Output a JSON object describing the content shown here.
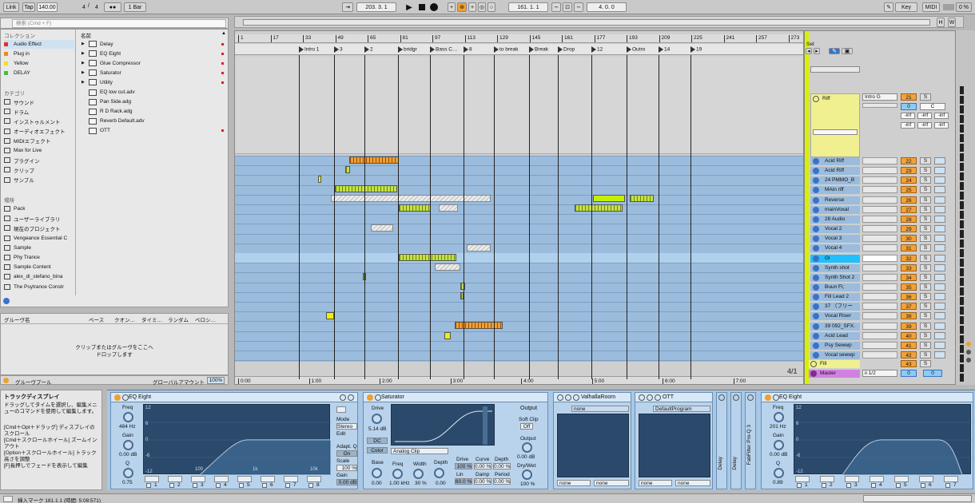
{
  "topbar": {
    "link": "Link",
    "tap": "Tap",
    "tempo": "140.00",
    "signature_num": "4",
    "signature_den": "4",
    "metronome": "●●",
    "quantize": "1 Bar",
    "position": "203.  3.  1",
    "loop_start": "161.  1.  1",
    "loop_length": "4.  0.  0",
    "key": "Key",
    "midi": "MIDI",
    "cpu": "0 %"
  },
  "browser": {
    "search_placeholder": "検索 (Cmd + F)",
    "collections_title": "コレクション",
    "collections": [
      {
        "label": "Audio Effect",
        "color": "#e03030"
      },
      {
        "label": "Plug in",
        "color": "#f08a20"
      },
      {
        "label": "Yellow",
        "color": "#f0e020"
      },
      {
        "label": "DELAY",
        "color": "#40c040"
      }
    ],
    "categories_title": "カテゴリ",
    "categories": [
      "サウンド",
      "ドラム",
      "インストゥルメント",
      "オーディオエフェクト",
      "MIDIエフェクト",
      "Max for Live",
      "プラグイン",
      "クリップ",
      "サンプル"
    ],
    "places_title": "場所",
    "places": [
      "Pack",
      "ユーザーライブラリ",
      "現在のプロジェクト",
      "Vengeance Essential C",
      "Sample",
      "Phy Trance",
      "Sample Content",
      "alex_di_stefano_bina",
      "The Psytrance Constr"
    ],
    "name_header": "名前",
    "files": [
      "Delay",
      "EQ Eight",
      "Glue Compressor",
      "Saturator",
      "Utility",
      "EQ low cut.adv",
      "Pan Side.adg",
      "R D Rack.adg",
      "Reverb Default.adv",
      "OTT"
    ]
  },
  "groove": {
    "headers": [
      "グルーヴ名",
      "ベース",
      "クオン…",
      "タイミ…",
      "ランダム",
      "ベロシ…"
    ],
    "drop_hint_1": "クリップまたはグルーヴをここへ",
    "drop_hint_2": "ドロップします",
    "pool_label": "グルーヴプール",
    "global_amount_label": "グローバルアマウント",
    "global_amount": "100%"
  },
  "arrangement": {
    "bars": [
      "1",
      "17",
      "33",
      "49",
      "65",
      "81",
      "97",
      "113",
      "129",
      "145",
      "161",
      "177",
      "193",
      "209",
      "225",
      "241",
      "257",
      "273"
    ],
    "locators": [
      "Intro 1",
      "3",
      "2",
      "bridgr",
      "Bass C…",
      "8",
      "to break",
      "Break",
      "Drop",
      "12",
      "Outro",
      "14",
      "19"
    ],
    "times": [
      "0:00",
      "1:00",
      "2:00",
      "3:00",
      "4:00",
      "5:00",
      "6:00",
      "7:00"
    ],
    "loop_fraction": "4/1"
  },
  "mixer": {
    "set_label": "Set",
    "riff": {
      "name": "Riff",
      "input": "Intro G",
      "num": "21",
      "vol": "0",
      "pan": "C",
      "inf": "-inf"
    },
    "tracks": [
      {
        "name": "Acid Riff",
        "num": "22"
      },
      {
        "name": "Acid Riff",
        "num": "23"
      },
      {
        "name": "24 PMMO_B",
        "num": "24"
      },
      {
        "name": "MAin riff",
        "num": "25"
      },
      {
        "name": "Reverse",
        "num": "26"
      },
      {
        "name": "mainVoxal",
        "num": "27"
      },
      {
        "name": "28 Audio",
        "num": "28"
      },
      {
        "name": "Vocal 2",
        "num": "29"
      },
      {
        "name": "Vocal 3",
        "num": "30"
      },
      {
        "name": "Vocal 4",
        "num": "31"
      },
      {
        "name": "Gl",
        "num": "32"
      },
      {
        "name": "Synth shot",
        "num": "33"
      },
      {
        "name": "Synth Shot 2",
        "num": "34"
      },
      {
        "name": "Buun Fi;",
        "num": "35"
      },
      {
        "name": "Fill Lead 2",
        "num": "36"
      },
      {
        "name": "37 （フリー",
        "num": "37"
      },
      {
        "name": "Vocal Riser",
        "num": "38"
      },
      {
        "name": "39 092_SFX.",
        "num": "39"
      },
      {
        "name": "Acid Lead",
        "num": "40"
      },
      {
        "name": "Psy Sewwp",
        "num": "41"
      },
      {
        "name": "Vocal sewwp",
        "num": "42"
      }
    ],
    "fill": {
      "name": "Fill",
      "num": "43"
    },
    "master": {
      "name": "Master",
      "input": "ii 1/2",
      "vol": "0",
      "pan": "0"
    },
    "solo": "S"
  },
  "info": {
    "title": "トラックディスプレイ",
    "lines": [
      "ドラッグしてタイムを選択し、編集メニューのコマンドを使用して編集します。",
      "[Cmd＋Opt＋ドラッグ] ディスプレイのスクロール",
      "[Cmd＋スクロールホイール] ズームインアウト",
      "[Option＋スクロールホイール] トラック高さを調整",
      "[F]長押しでフェードを表示して編集"
    ]
  },
  "devices": {
    "eq1": {
      "title": "EQ Eight",
      "freq_label": "Freq",
      "freq": "484 Hz",
      "gain_label": "Gain",
      "gain": "0.00 dB",
      "q_label": "Q",
      "q": "0.75",
      "mode_label": "Mode",
      "mode": "Stereo",
      "edit_label": "Edit",
      "adapt_label": "Adapt. Q",
      "adapt": "On",
      "scale_label": "Scale",
      "scale": "100 %",
      "out_gain_label": "Gain",
      "out_gain": "0.00 dB",
      "db_ticks": [
        "12",
        "6",
        "0",
        "-6",
        "-12"
      ],
      "freq_ticks": [
        "100",
        "1k",
        "10k"
      ],
      "bands": [
        "1",
        "2",
        "3",
        "4",
        "5",
        "6",
        "7",
        "8"
      ]
    },
    "saturator": {
      "title": "Saturator",
      "drive_label": "Drive",
      "drive": "5.14 dB",
      "dc": "DC",
      "color": "Color",
      "type": "Analog Clip",
      "base_label": "Base",
      "base": "0.00",
      "freq_label": "Freq",
      "freq": "1.00 kHz",
      "width_label": "Width",
      "width": "30 %",
      "depth_label": "Depth",
      "depth": "0.00",
      "drive2_label": "Drive",
      "drive2": "100 %",
      "curve_label": "Curve",
      "curve": "0.00 %",
      "depth2_label": "Depth",
      "depth2": "0.00 %",
      "lin_label": "Lin",
      "lin": "60.0 %",
      "damp_label": "Damp",
      "damp": "0.00 %",
      "period_label": "Period",
      "period": "0.00 %",
      "output_label": "Output",
      "softclip_label": "Soft Clip",
      "softclip": "Off",
      "output2_label": "Output",
      "output": "0.00 dB",
      "drywet_label": "Dry/Wet",
      "drywet": "100 %"
    },
    "valhalla": {
      "title": "ValhallaRoom",
      "preset": "none",
      "opt1": "none",
      "opt2": "none"
    },
    "ott": {
      "title": "OTT",
      "preset": "DefaultProgram",
      "opt1": "none",
      "opt2": "none"
    },
    "delay1": "Delay",
    "delay2": "Delay",
    "fabfilter": "FabFilter Pro-Q 3",
    "eq2": {
      "title": "EQ Eight",
      "freq_label": "Freq",
      "freq": "201 Hz",
      "gain_label": "Gain",
      "gain": "0.00 dB",
      "q_label": "Q",
      "q": "0.89",
      "db_ticks": [
        "12",
        "6",
        "0",
        "-6",
        "-12"
      ],
      "bands": [
        "1",
        "2",
        "3",
        "4",
        "5",
        "6",
        "7"
      ]
    }
  },
  "status": {
    "text": "挿入マーク 181.1.1 (時間: 5:08:571)"
  }
}
